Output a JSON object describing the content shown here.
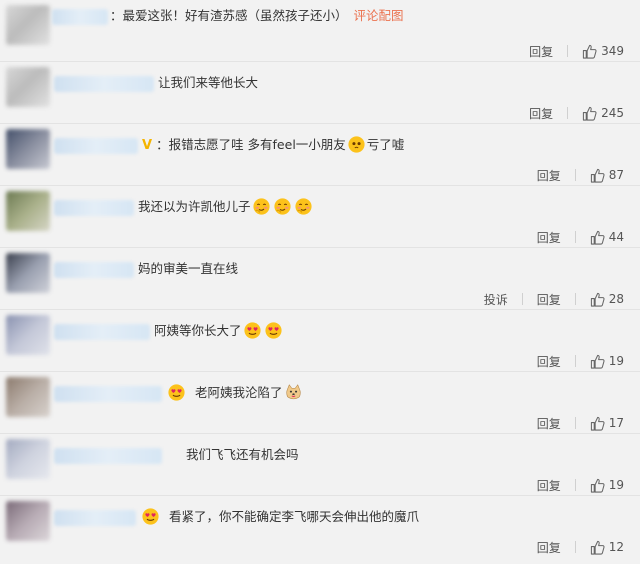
{
  "comments": [
    {
      "text": "：最爱这张！好有渣苏感（虽然孩子还小）",
      "link": "评论配图",
      "reply": "回复",
      "likes": "349"
    },
    {
      "text": "让我们来等他长大",
      "reply": "回复",
      "likes": "245"
    },
    {
      "text_a": "：报错志愿了哇 多有feel一小朋友",
      "text_b": "亏了嘘",
      "reply": "回复",
      "likes": "87"
    },
    {
      "text": "我还以为许凯他儿子",
      "reply": "回复",
      "likes": "44"
    },
    {
      "text": "妈的审美一直在线",
      "report": "投诉",
      "reply": "回复",
      "likes": "28"
    },
    {
      "text": "阿姨等你长大了",
      "reply": "回复",
      "likes": "19"
    },
    {
      "text": "老阿姨我沦陷了",
      "reply": "回复",
      "likes": "17"
    },
    {
      "text": "我们飞飞还有机会吗",
      "reply": "回复",
      "likes": "19"
    },
    {
      "text": "看紧了，你不能确定李飞哪天会伸出他的魔爪",
      "reply": "回复",
      "likes": "12"
    }
  ],
  "icons": {
    "thumb": "thumbs-up-icon",
    "heart_eyes": "heart-eyes-emoji",
    "smirk": "smirk-emoji",
    "pleading": "pleading-emoji",
    "doge": "doge-emoji"
  },
  "colors": {
    "link": "#eb7350",
    "name_blur": "#d6e6f4",
    "background": "#f2f2f2"
  }
}
